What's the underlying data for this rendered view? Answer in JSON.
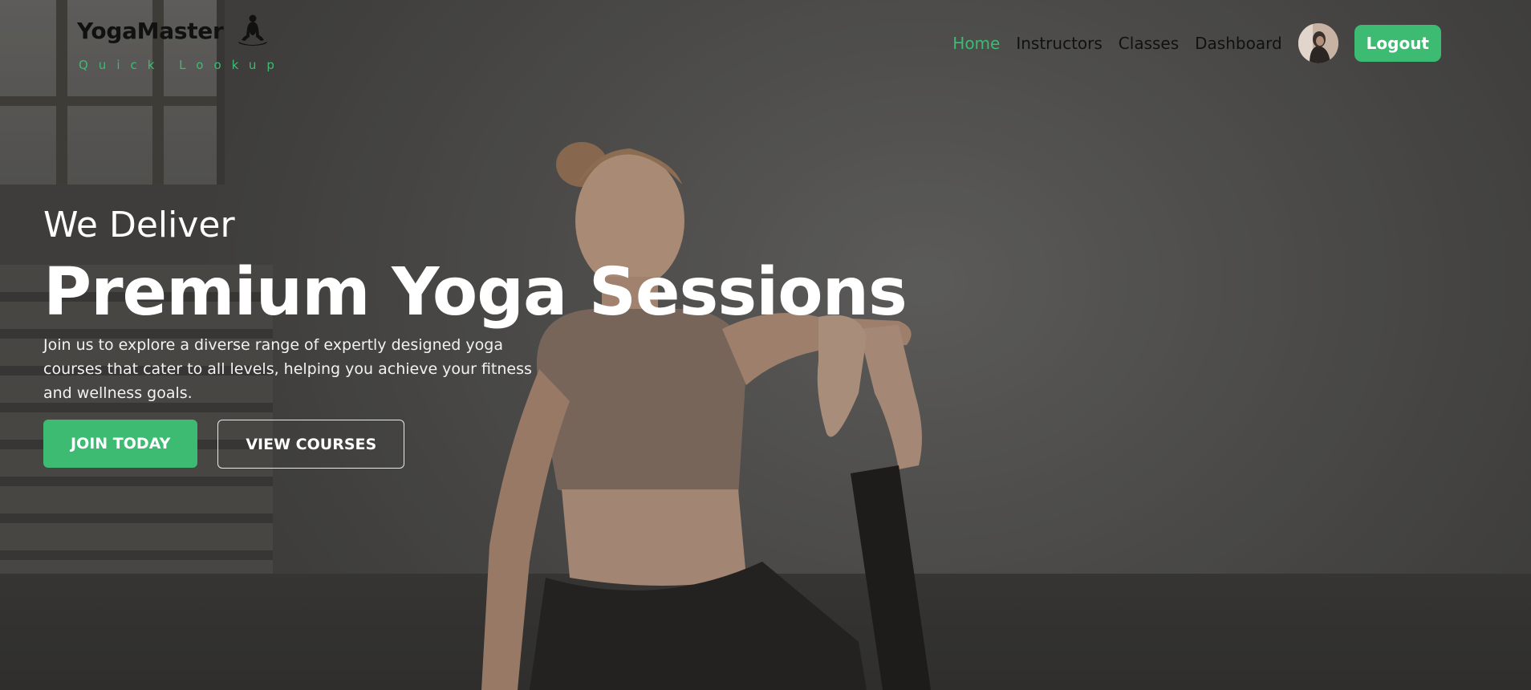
{
  "brand": {
    "name": "YogaMaster",
    "tagline": "Quick Lookup"
  },
  "nav": {
    "links": [
      {
        "label": "Home",
        "active": true
      },
      {
        "label": "Instructors",
        "active": false
      },
      {
        "label": "Classes",
        "active": false
      },
      {
        "label": "Dashboard",
        "active": false
      }
    ],
    "logout_label": "Logout"
  },
  "hero": {
    "pre_title": "We Deliver",
    "title": "Premium Yoga Sessions",
    "description": "Join us to explore a diverse range of expertly designed yoga courses that cater to all levels, helping you achieve your fitness and wellness goals.",
    "primary_button": "JOIN TODAY",
    "secondary_button": "VIEW COURSES"
  },
  "colors": {
    "accent": "#3dbb72",
    "nav_text": "#111111",
    "hero_text": "#ffffff"
  },
  "icons": {
    "logo": "meditation-figure-icon",
    "avatar": "user-avatar"
  }
}
